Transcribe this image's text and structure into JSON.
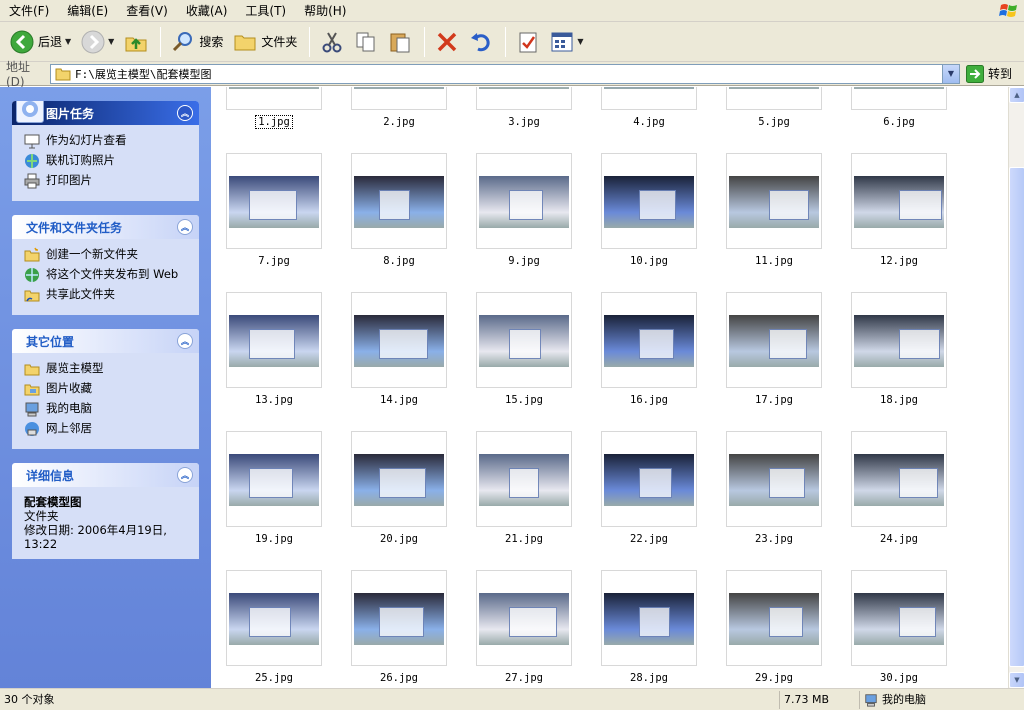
{
  "menu": [
    "文件(F)",
    "编辑(E)",
    "查看(V)",
    "收藏(A)",
    "工具(T)",
    "帮助(H)"
  ],
  "toolbar": {
    "back_label": "后退",
    "search_label": "搜索",
    "folders_label": "文件夹"
  },
  "address": {
    "label": "地址 (D)",
    "path": "F:\\展览主模型\\配套模型图",
    "go_label": "转到"
  },
  "sidebar": {
    "picture_tasks": {
      "title": "图片任务",
      "items": [
        {
          "label": "作为幻灯片查看",
          "icon": "slideshow-icon"
        },
        {
          "label": "联机订购照片",
          "icon": "order-photos-icon"
        },
        {
          "label": "打印图片",
          "icon": "print-icon"
        }
      ]
    },
    "file_tasks": {
      "title": "文件和文件夹任务",
      "items": [
        {
          "label": "创建一个新文件夹",
          "icon": "new-folder-icon"
        },
        {
          "label": "将这个文件夹发布到 Web",
          "icon": "publish-web-icon"
        },
        {
          "label": "共享此文件夹",
          "icon": "share-folder-icon"
        }
      ]
    },
    "other_places": {
      "title": "其它位置",
      "items": [
        {
          "label": "展览主模型",
          "icon": "folder-icon"
        },
        {
          "label": "图片收藏",
          "icon": "my-pictures-icon"
        },
        {
          "label": "我的电脑",
          "icon": "my-computer-icon"
        },
        {
          "label": "网上邻居",
          "icon": "network-icon"
        }
      ]
    },
    "details": {
      "title": "详细信息",
      "name": "配套模型图",
      "type": "文件夹",
      "modified": "修改日期: 2006年4月19日, 13:22"
    }
  },
  "files": [
    "1.jpg",
    "2.jpg",
    "3.jpg",
    "4.jpg",
    "5.jpg",
    "6.jpg",
    "7.jpg",
    "8.jpg",
    "9.jpg",
    "10.jpg",
    "11.jpg",
    "12.jpg",
    "13.jpg",
    "14.jpg",
    "15.jpg",
    "16.jpg",
    "17.jpg",
    "18.jpg",
    "19.jpg",
    "20.jpg",
    "21.jpg",
    "22.jpg",
    "23.jpg",
    "24.jpg",
    "25.jpg",
    "26.jpg",
    "27.jpg",
    "28.jpg",
    "29.jpg",
    "30.jpg"
  ],
  "selected_file": "1.jpg",
  "status": {
    "count": "30 个对象",
    "size": "7.73 MB",
    "location": "我的电脑"
  },
  "colors": {
    "sidebar_bg": "#7b9ee8",
    "panel_bg": "#d6dff7",
    "header_text": "#215dc6",
    "chrome_bg": "#ece9d8"
  }
}
